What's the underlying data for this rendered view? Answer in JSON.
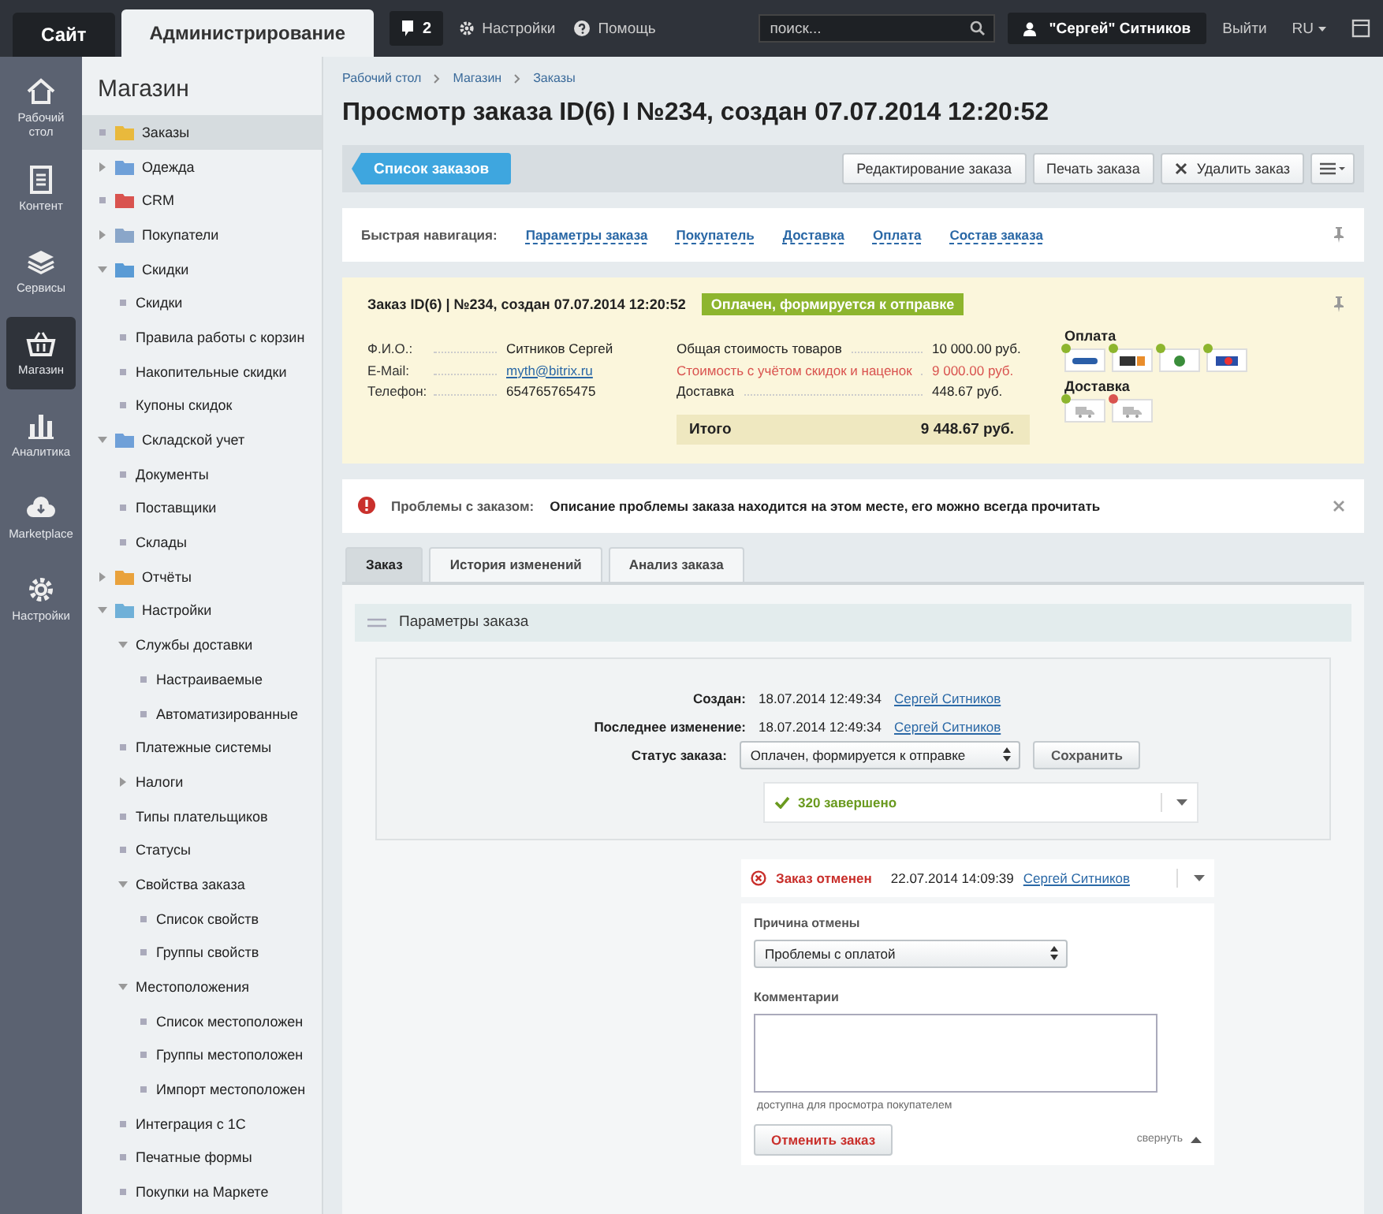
{
  "top_bar": {
    "tabs": [
      {
        "label": "Сайт",
        "selected": false
      },
      {
        "label": "Администрирование",
        "selected": true
      }
    ],
    "notifications": "2",
    "links": [
      "Настройки",
      "Помощь"
    ],
    "search": {
      "placeholder": "поиск..."
    },
    "user": "\"Сергей\" Ситников",
    "logout": "Выйти",
    "language": "RU"
  },
  "rail": [
    {
      "label": "Рабочий стол",
      "selected": false
    },
    {
      "label": "Контент",
      "selected": false
    },
    {
      "label": "Сервисы",
      "selected": false
    },
    {
      "label": "Магазин",
      "selected": true
    },
    {
      "label": "Аналитика",
      "selected": false
    },
    {
      "label": "Marketplace",
      "selected": false
    },
    {
      "label": "Настройки",
      "selected": false
    }
  ],
  "sidebar": {
    "title": "Магазин",
    "items": [
      {
        "label": "Заказы",
        "selected": true
      },
      {
        "label": "Одежда",
        "selected": false,
        "expanded": false
      },
      {
        "label": "CRM",
        "selected": false
      },
      {
        "label": "Покупатели",
        "selected": false,
        "expanded": false
      },
      {
        "label": "Скидки",
        "selected": false,
        "expanded": true,
        "children": [
          {
            "label": "Скидки",
            "selected": false
          },
          {
            "label": "Правила работы с корзин",
            "selected": false
          },
          {
            "label": "Накопительные скидки",
            "selected": false
          },
          {
            "label": "Купоны скидок",
            "selected": false
          }
        ]
      },
      {
        "label": "Складской учет",
        "selected": false,
        "expanded": true,
        "children": [
          {
            "label": "Документы",
            "selected": false
          },
          {
            "label": "Поставщики",
            "selected": false
          },
          {
            "label": "Склады",
            "selected": false
          }
        ]
      },
      {
        "label": "Отчёты",
        "selected": false,
        "expanded": false
      },
      {
        "label": "Настройки",
        "selected": false,
        "expanded": true,
        "children": [
          {
            "label": "Службы доставки",
            "selected": false,
            "expanded": true,
            "children": [
              {
                "label": "Настраиваемые",
                "selected": false
              },
              {
                "label": "Автоматизированные",
                "selected": false
              }
            ]
          },
          {
            "label": "Платежные системы",
            "selected": false
          },
          {
            "label": "Налоги",
            "selected": false,
            "expanded": false
          },
          {
            "label": "Типы плательщиков",
            "selected": false
          },
          {
            "label": "Статусы",
            "selected": false
          },
          {
            "label": "Свойства заказа",
            "selected": false,
            "expanded": true,
            "children": [
              {
                "label": "Список свойств",
                "selected": false
              },
              {
                "label": "Группы свойств",
                "selected": false
              }
            ]
          },
          {
            "label": "Местоположения",
            "selected": false,
            "expanded": true,
            "children": [
              {
                "label": "Список местоположен",
                "selected": false
              },
              {
                "label": "Группы местоположен",
                "selected": false
              },
              {
                "label": "Импорт местоположен",
                "selected": false
              }
            ]
          },
          {
            "label": "Интеграция с 1С",
            "selected": false
          },
          {
            "label": "Печатные формы",
            "selected": false
          },
          {
            "label": "Покупки на Маркете",
            "selected": false
          }
        ]
      }
    ]
  },
  "breadcrumbs": [
    "Рабочий стол",
    "Магазин",
    "Заказы"
  ],
  "title": "Просмотр заказа ID(6) I №234, создан 07.07.2014 12:20:52",
  "toolbar": {
    "back": "Список заказов",
    "buttons": [
      {
        "label": "Редактирование заказа",
        "kind": "plain"
      },
      {
        "label": "Печать заказа",
        "kind": "plain"
      },
      {
        "label": "Удалить заказ",
        "kind": "delete"
      }
    ]
  },
  "quick_nav": {
    "label": "Быстрая навигация:",
    "links": [
      "Параметры заказа",
      "Покупатель",
      "Доставка",
      "Оплата",
      "Состав заказа"
    ]
  },
  "summary": {
    "title": "Заказ ID(6) | №234, создан 07.07.2014 12:20:52",
    "status": "Оплачен, формируется к отправке",
    "customer": [
      {
        "label": "Ф.И.О.:",
        "value": "Ситников Сергей",
        "kind": "text"
      },
      {
        "label": "E-Mail:",
        "value": "myth@bitrix.ru",
        "kind": "link"
      },
      {
        "label": "Телефон:",
        "value": "654765765475",
        "kind": "text"
      }
    ],
    "costs": [
      {
        "label": "Общая стоимость товаров",
        "value": "10 000.00 руб.",
        "kind": "normal"
      },
      {
        "label": "Стоимость с учётом скидок и наценок",
        "value": "9 000.00 руб.",
        "kind": "discount"
      },
      {
        "label": "Доставка",
        "value": "448.67 руб.",
        "kind": "normal"
      }
    ],
    "total": {
      "label": "Итого",
      "value": "9 448.67 руб."
    },
    "payment": {
      "title": "Оплата",
      "methods": [
        {
          "color": "#8db52e"
        },
        {
          "color": "#8db52e"
        },
        {
          "color": "#8db52e"
        },
        {
          "color": "#8db52e"
        }
      ]
    },
    "delivery": {
      "title": "Доставка",
      "methods": [
        {
          "color": "#8db52e"
        },
        {
          "color": "#d9534f"
        }
      ]
    }
  },
  "alert": {
    "label": "Проблемы с заказом:",
    "message": "Описание проблемы заказа находится на этом месте, его можно всегда прочитать"
  },
  "tabs": [
    {
      "label": "Заказ",
      "selected": true
    },
    {
      "label": "История изменений",
      "selected": false
    },
    {
      "label": "Анализ заказа",
      "selected": false
    }
  ],
  "section": {
    "title": "Параметры заказа",
    "fields": [
      {
        "label": "Создан:",
        "date": "18.07.2014 12:49:34",
        "user": "Сергей Ситников"
      },
      {
        "label": "Последнее изменение:",
        "date": "18.07.2014 12:49:34",
        "user": "Сергей Ситников"
      }
    ],
    "status": {
      "label": "Статус заказа:",
      "value": "Оплачен, формируется к отправке",
      "save": "Сохранить"
    },
    "progress": "320 завершено"
  },
  "cancel": {
    "status": "Заказ отменен",
    "date": "22.07.2014 14:09:39",
    "user": "Сергей Ситников",
    "reason_label": "Причина отмены",
    "reason": "Проблемы с оплатой",
    "comment_label": "Комментарии",
    "hint": "доступна для просмотра покупателем",
    "button": "Отменить заказ",
    "collapse": "свернуть"
  }
}
